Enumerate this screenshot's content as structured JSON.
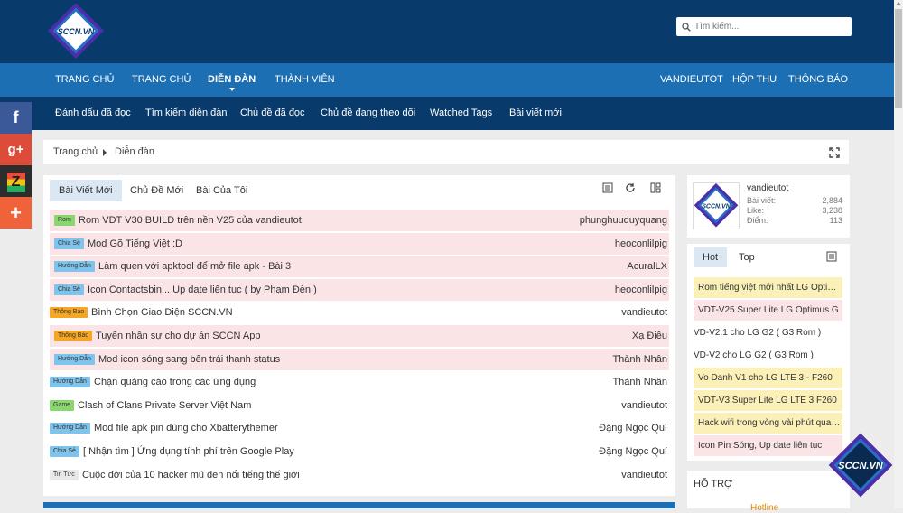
{
  "header": {
    "logo_text": "SCCN.VN",
    "search_placeholder": "Tìm kiếm..."
  },
  "nav": {
    "left": [
      "TRANG CHỦ",
      "TRANG CHỦ",
      "DIỄN ĐÀN",
      "THÀNH VIÊN"
    ],
    "right": [
      "VANDIEUTOT",
      "HỘP THƯ",
      "THÔNG BÁO"
    ],
    "active": "DIỄN ĐÀN"
  },
  "subnav": [
    "Đánh dấu đã đọc",
    "Tìm kiếm diễn đàn",
    "Chủ đề đã đọc",
    "Chủ đề đang theo dõi",
    "Watched Tags",
    "Bài viết mới"
  ],
  "social": [
    {
      "icon": "facebook-icon",
      "glyph": "f",
      "color": "#3b5998"
    },
    {
      "icon": "google-plus-icon",
      "glyph": "g+",
      "color": "#dd4b39"
    },
    {
      "icon": "zing-icon",
      "glyph": "Z",
      "color": "#2d2d2d"
    },
    {
      "icon": "plus-icon",
      "glyph": "+",
      "color": "#f0623a"
    }
  ],
  "breadcrumb": [
    "Trang chủ",
    "Diễn đàn"
  ],
  "tabs": [
    "Bài Viết Mới",
    "Chủ Đề Mới",
    "Bài Của Tôi"
  ],
  "threads": [
    {
      "label": "Rom",
      "label_color": "#8ad66f",
      "title": "Rom VDT V30 BUILD trên nền V25 của vandieutot",
      "user": "phunghuuduyquang",
      "highlight": true
    },
    {
      "label": "Chia Sẻ",
      "label_color": "#7fc4ec",
      "title": "Mod Gõ Tiếng Việt :D",
      "user": "heoconlilpig",
      "highlight": true
    },
    {
      "label": "Hướng Dẫn",
      "label_color": "#7fc4ec",
      "title": "Làm quen với apktool để mở file apk - Bài 3",
      "user": "AcuralLX",
      "highlight": true
    },
    {
      "label": "Chia Sẻ",
      "label_color": "#7fc4ec",
      "title": "Icon Contactsbin... Up date liên tục ( by Phạm Đèn )",
      "user": "heoconlilpig",
      "highlight": true
    },
    {
      "label": "Thông Báo",
      "label_color": "#f5a623",
      "title": "Bình Chọn Giao Diện SCCN.VN",
      "user": "vandieutot",
      "highlight": false
    },
    {
      "label": "Thông Báo",
      "label_color": "#f5a623",
      "title": "Tuyển nhân sự cho dự án SCCN App",
      "user": "Xạ Điêu",
      "highlight": true
    },
    {
      "label": "Hướng Dẫn",
      "label_color": "#7fc4ec",
      "title": "Mod icon sóng sang bên trái thanh status",
      "user": "Thành Nhân",
      "highlight": true
    },
    {
      "label": "Hướng Dẫn",
      "label_color": "#7fc4ec",
      "title": "Chặn quảng cáo trong các ứng dụng",
      "user": "Thành Nhân",
      "highlight": false
    },
    {
      "label": "Game",
      "label_color": "#8ad66f",
      "title": "Clash of Clans Private Server Việt Nam",
      "user": "vandieutot",
      "highlight": false
    },
    {
      "label": "Hướng Dẫn",
      "label_color": "#7fc4ec",
      "title": "Mod file apk pin dùng cho Xbatterythemer",
      "user": "Đặng Ngọc Quí",
      "highlight": false
    },
    {
      "label": "Chia Sẻ",
      "label_color": "#7fc4ec",
      "title": "[ Nhận tìm ] Ứng dụng tính phí trên Google Play",
      "user": "Đặng Ngọc Quí",
      "highlight": false
    },
    {
      "label": "Tin Tức",
      "label_color": "#e8e8e8",
      "title": "Cuộc đời của 10 hacker mũ đen nổi tiếng thế giới",
      "user": "vandieutot",
      "highlight": false
    }
  ],
  "user_card": {
    "name": "vandieutot",
    "stats": [
      {
        "label": "Bài viết:",
        "value": "2,884"
      },
      {
        "label": "Like:",
        "value": "3,238"
      },
      {
        "label": "Điểm:",
        "value": "113"
      }
    ]
  },
  "side_tabs": [
    "Hot",
    "Top"
  ],
  "hot_items": [
    {
      "text": "Rom tiếng việt mới nhất LG Optimus G",
      "style": "y"
    },
    {
      "text": "VDT-V25 Super Lite LG Optimus G",
      "style": "p"
    },
    {
      "text": "VD-V2.1 cho LG G2 ( G3 Rom )",
      "style": "w"
    },
    {
      "text": "VD-V2 cho LG G2 ( G3 Rom )",
      "style": "w"
    },
    {
      "text": "Vo Danh V1 cho LG LTE 3 - F260",
      "style": "y"
    },
    {
      "text": "VDT-V3 Super Lite LG LTE 3 F260",
      "style": "y"
    },
    {
      "text": "Hack wifi trong vòng vài phút qua WPS",
      "style": "y"
    },
    {
      "text": "Icon Pin Sóng, Up date liên tục",
      "style": "p"
    }
  ],
  "support": {
    "title": "HỖ TRỢ",
    "hotline": "Hotline"
  }
}
